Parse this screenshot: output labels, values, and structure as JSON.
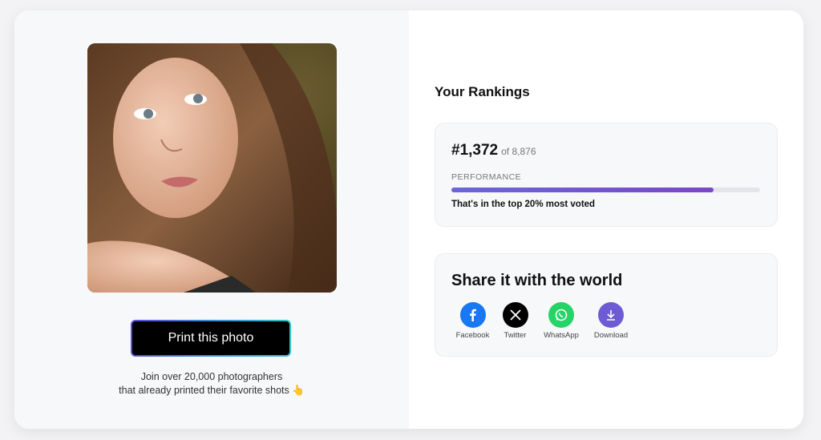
{
  "left": {
    "photo_alt": "Portrait photo",
    "print_button": "Print this photo",
    "join_line1": "Join over 20,000 photographers",
    "join_line2": "that already printed their favorite shots",
    "join_emoji": "👆"
  },
  "rankings": {
    "title": "Your Rankings",
    "rank": "#1,372",
    "of": "of 8,876",
    "performance_label": "PERFORMANCE",
    "performance_fraction": 0.85,
    "summary": "That's in the top 20% most voted"
  },
  "share": {
    "title": "Share it with the world",
    "items": [
      {
        "label": "Facebook",
        "icon": "facebook-icon",
        "color": "#1877f2"
      },
      {
        "label": "Twitter",
        "icon": "x-icon",
        "color": "#000000"
      },
      {
        "label": "WhatsApp",
        "icon": "whatsapp-icon",
        "color": "#25d366"
      },
      {
        "label": "Download",
        "icon": "download-icon",
        "color": "#6c5bd4"
      }
    ]
  }
}
